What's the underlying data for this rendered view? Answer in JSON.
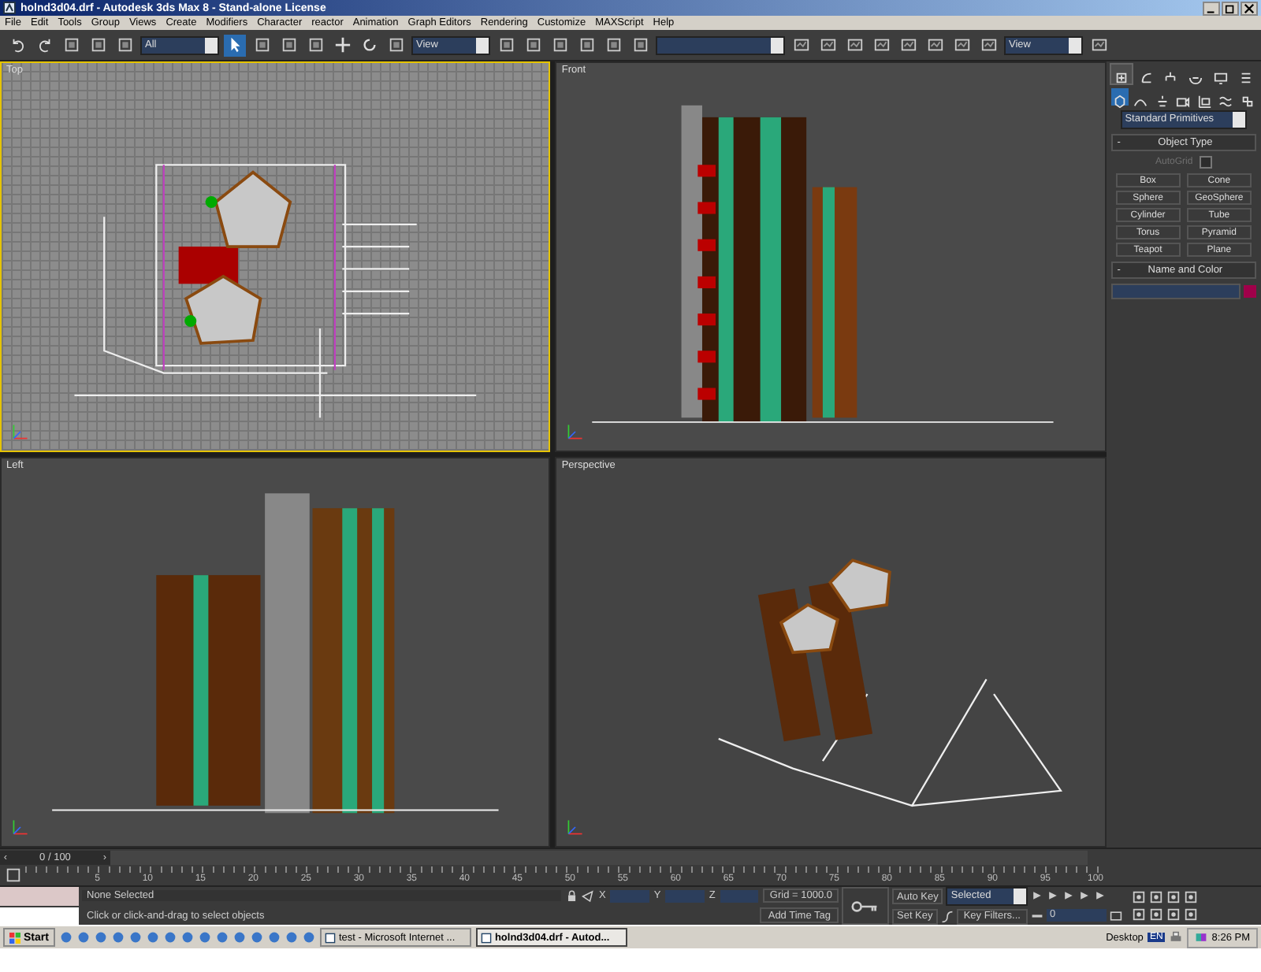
{
  "window": {
    "title": "holnd3d04.drf - Autodesk 3ds Max 8  - Stand-alone License"
  },
  "menu": [
    "File",
    "Edit",
    "Tools",
    "Group",
    "Views",
    "Create",
    "Modifiers",
    "Character",
    "reactor",
    "Animation",
    "Graph Editors",
    "Rendering",
    "Customize",
    "MAXScript",
    "Help"
  ],
  "toolbar": {
    "selection_filter": "All",
    "reference_coordinate": "View",
    "render_view": "View"
  },
  "viewports": [
    {
      "label": "Top",
      "kind": "top",
      "active": true
    },
    {
      "label": "Front",
      "kind": "front",
      "active": false
    },
    {
      "label": "Left",
      "kind": "left",
      "active": false
    },
    {
      "label": "Perspective",
      "kind": "perspective",
      "active": false
    }
  ],
  "command_panel": {
    "tabs": [
      {
        "kind": "create",
        "selected": true
      },
      {
        "kind": "modify",
        "selected": false
      },
      {
        "kind": "hierarchy",
        "selected": false
      },
      {
        "kind": "motion",
        "selected": false
      },
      {
        "kind": "display",
        "selected": false
      },
      {
        "kind": "utilities",
        "selected": false
      }
    ],
    "categories": [
      {
        "kind": "geometry",
        "selected": true
      },
      {
        "kind": "shapes",
        "selected": false
      },
      {
        "kind": "lights",
        "selected": false
      },
      {
        "kind": "cameras",
        "selected": false
      },
      {
        "kind": "helpers",
        "selected": false
      },
      {
        "kind": "spacewarps",
        "selected": false
      },
      {
        "kind": "systems",
        "selected": false
      }
    ],
    "dropdown": "Standard Primitives",
    "object_type": {
      "collapse": "-",
      "title": "Object Type",
      "autogrid": {
        "label": "AutoGrid",
        "checked": false,
        "disabled": true
      },
      "buttons": [
        "Box",
        "Cone",
        "Sphere",
        "GeoSphere",
        "Cylinder",
        "Tube",
        "Torus",
        "Pyramid",
        "Teapot",
        "Plane"
      ]
    },
    "name_and_color": {
      "collapse": "-",
      "title": "Name and Color",
      "color": "#a0004a"
    }
  },
  "timeline": {
    "prev": "‹",
    "slider": "0 / 100",
    "next": "›",
    "level": 0,
    "ticks": [
      "5",
      "10",
      "15",
      "20",
      "25",
      "30",
      "35",
      "40",
      "45",
      "50",
      "55",
      "60",
      "65",
      "70",
      "75",
      "80",
      "85",
      "90",
      "95",
      "100"
    ]
  },
  "status": {
    "selection": "None Selected",
    "prompt": "Click or click-and-drag to select objects",
    "x_label": "X",
    "y_label": "Y",
    "z_label": "Z",
    "grid": "Grid = 1000.0",
    "add_time_tag": "Add Time Tag",
    "auto_key": "Auto Key",
    "key_mode": "Selected",
    "set_key": "Set Key",
    "key_filters": "Key Filters...",
    "frame": "0"
  },
  "taskbar": {
    "start": "Start",
    "tasks": [
      {
        "label": "test - Microsoft Internet ...",
        "selected": false
      },
      {
        "label": "holnd3d04.drf - Autod...",
        "selected": true
      }
    ],
    "desktop": "Desktop",
    "language": "EN",
    "clock": "8:26 PM"
  }
}
